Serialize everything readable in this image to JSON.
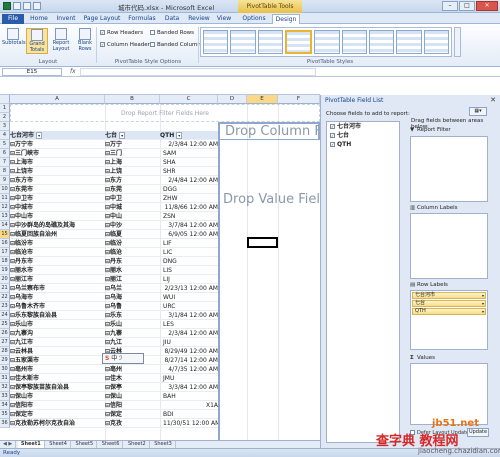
{
  "window": {
    "title": "城市代码.xlsx - Microsoft Excel",
    "context_tab": "PivotTable Tools",
    "controls": [
      "–",
      "□",
      "✕"
    ]
  },
  "tabs": [
    "File",
    "Home",
    "Invent",
    "Page Layout",
    "Formulas",
    "Data",
    "Review",
    "View",
    "Options",
    "Design"
  ],
  "ribbon": {
    "layout_buttons": [
      "Subtotals",
      "Grand Totals",
      "Report Layout",
      "Blank Rows"
    ],
    "layout_label": "Layout",
    "options": [
      {
        "label": "Row Headers",
        "checked": true
      },
      {
        "label": "Banded Rows",
        "checked": false
      },
      {
        "label": "Column Headers",
        "checked": true
      },
      {
        "label": "Banded Columns",
        "checked": false
      }
    ],
    "options_label": "PivotTable Style Options",
    "styles_label": "PivotTable Styles"
  },
  "formula_bar": {
    "name_box": "E15",
    "fx": "fx",
    "value": ""
  },
  "grid": {
    "columns": [
      "A",
      "B",
      "C",
      "D",
      "E",
      "F"
    ],
    "drop_report": "Drop Report Filter Fields Here",
    "drop_column": "Drop Column Fields Here",
    "drop_value": "Drop Value Fields Here",
    "header_row": {
      "a": "七台河市",
      "b": "七台",
      "c": "QTH"
    },
    "rows": [
      {
        "n": "1"
      },
      {
        "n": "2"
      },
      {
        "n": "3"
      },
      {
        "n": "4"
      },
      {
        "n": "5",
        "a": "万宁市",
        "b": "万宁",
        "c": "2/3/84 12:00 AM"
      },
      {
        "n": "6",
        "a": "三门峡市",
        "b": "三门",
        "c": "SAM"
      },
      {
        "n": "7",
        "a": "上海市",
        "b": "上海",
        "c": "SHA"
      },
      {
        "n": "8",
        "a": "上饶市",
        "b": "上饶",
        "c": "SHR"
      },
      {
        "n": "9",
        "a": "东方市",
        "b": "东方",
        "c": "2/4/84 12:00 AM"
      },
      {
        "n": "10",
        "a": "东莞市",
        "b": "东莞",
        "c": "DGG"
      },
      {
        "n": "11",
        "a": "中卫市",
        "b": "中卫",
        "c": "ZHW"
      },
      {
        "n": "12",
        "a": "中城市",
        "b": "中城",
        "c": "11/8/66 12:00 AM"
      },
      {
        "n": "13",
        "a": "中山市",
        "b": "中山",
        "c": "ZSN"
      },
      {
        "n": "14",
        "a": "中沙群岛的岛礁及其海",
        "b": "中沙",
        "c": "3/7/84 12:00 AM"
      },
      {
        "n": "15",
        "a": "临夏回族自治州",
        "b": "临夏",
        "c": "6/9/05 12:00 AM"
      },
      {
        "n": "16",
        "a": "临汾市",
        "b": "临汾",
        "c": "LIF"
      },
      {
        "n": "17",
        "a": "临沧市",
        "b": "临沧",
        "c": "LIC"
      },
      {
        "n": "18",
        "a": "丹东市",
        "b": "丹东",
        "c": "DNG"
      },
      {
        "n": "19",
        "a": "丽水市",
        "b": "丽水",
        "c": "LIS"
      },
      {
        "n": "20",
        "a": "丽江市",
        "b": "丽江",
        "c": "LIJ"
      },
      {
        "n": "21",
        "a": "乌兰察布市",
        "b": "乌兰",
        "c": "2/23/13 12:00 AM"
      },
      {
        "n": "22",
        "a": "乌海市",
        "b": "乌海",
        "c": "WUI"
      },
      {
        "n": "23",
        "a": "乌鲁木齐市",
        "b": "乌鲁",
        "c": "URC"
      },
      {
        "n": "24",
        "a": "乐东黎族自治县",
        "b": "乐东",
        "c": "3/1/84 12:00 AM"
      },
      {
        "n": "25",
        "a": "乐山市",
        "b": "乐山",
        "c": "LES"
      },
      {
        "n": "26",
        "a": "九寨沟",
        "b": "九寨",
        "c": "2/3/84 12:00 AM"
      },
      {
        "n": "27",
        "a": "九江市",
        "b": "九江",
        "c": "JIU"
      },
      {
        "n": "28",
        "a": "云林县",
        "b": "云林",
        "c": "8/29/49 12:00 AM"
      },
      {
        "n": "29",
        "a": "五家渠市",
        "b": "五家",
        "c": "8/27/14 12:00 AM"
      },
      {
        "n": "30",
        "a": "亳州市",
        "b": "亳州",
        "c": "4/7/35 12:00 AM"
      },
      {
        "n": "31",
        "a": "佳木斯市",
        "b": "佳木",
        "c": "JMU"
      },
      {
        "n": "32",
        "a": "保亭黎族苗族自治县",
        "b": "保亭",
        "c": "3/3/84 12:00 AM"
      },
      {
        "n": "33",
        "a": "保山市",
        "b": "保山",
        "c": "BAH"
      },
      {
        "n": "34",
        "a": "信阳市",
        "b": "信阳",
        "c": "X1A"
      },
      {
        "n": "35",
        "a": "保定市",
        "b": "保定",
        "c": "BDI"
      },
      {
        "n": "36",
        "a": "克孜勒苏柯尔克孜自治",
        "b": "克孜",
        "c": "11/30/51 12:00 AM"
      }
    ],
    "active_cell": "E15",
    "ime": {
      "icon": "S",
      "text": "中",
      "punct": "ℐ"
    }
  },
  "sheet_tabs": [
    "Sheet1",
    "Sheet4",
    "Sheet5",
    "Sheet6",
    "Sheet2",
    "Sheet3"
  ],
  "status": {
    "left": "Ready"
  },
  "field_list": {
    "title": "PivotTable Field List",
    "choose_label": "Choose fields to add to report:",
    "fields": [
      {
        "label": "七台河市",
        "checked": true
      },
      {
        "label": "七台",
        "checked": true
      },
      {
        "label": "QTH",
        "checked": true
      }
    ],
    "drag_label": "Drag fields between areas below:",
    "report_filter": "Report Filter",
    "column_labels": "Column Labels",
    "row_labels": "Row Labels",
    "values": "Values",
    "row_items": [
      "七台河市",
      "七台",
      "QTH"
    ],
    "defer_label": "Defer Layout Update",
    "update_label": "Update"
  },
  "watermark": {
    "site": "jb51.net",
    "brand": "查字典 教程网",
    "url": "jiaocheng.chazidian.com"
  }
}
